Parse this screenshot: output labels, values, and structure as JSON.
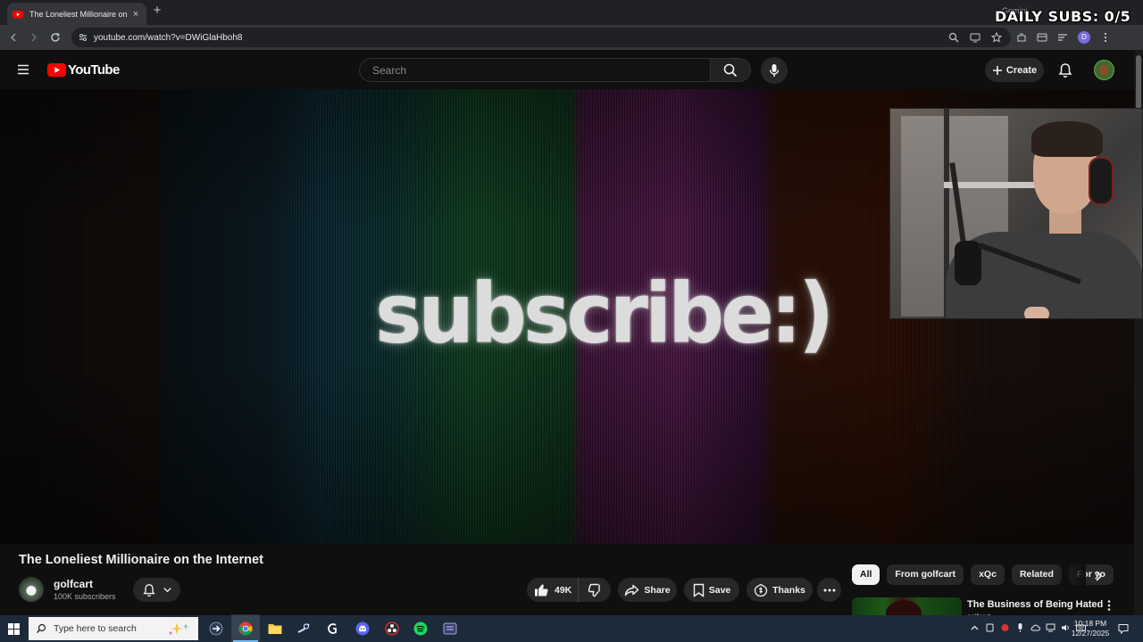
{
  "browser": {
    "tab_title": "The Loneliest Millionaire on the Internet",
    "tab_close": "×",
    "new_tab": "+",
    "gemini_label": "Gemini",
    "url": "youtube.com/watch?v=DWiGlaHboh8",
    "profile_initial": "D"
  },
  "overlay": {
    "daily_subs": "DAILY SUBS: 0/5"
  },
  "youtube": {
    "logo_text": "YouTube",
    "search_placeholder": "Search",
    "create_label": "Create"
  },
  "video": {
    "overlay_text": "subscribe:)",
    "title": "The Loneliest Millionaire on the Internet"
  },
  "channel": {
    "name": "golfcart",
    "subscribers": "100K subscribers"
  },
  "actions": {
    "like_count": "49K",
    "share": "Share",
    "save": "Save",
    "thanks": "Thanks"
  },
  "chips": [
    "All",
    "From golfcart",
    "xQc",
    "Related",
    "For yo"
  ],
  "recommendation": {
    "title": "The Business of Being Hated",
    "channel": "golfcart"
  },
  "taskbar": {
    "search_placeholder": "Type here to search",
    "time": "10:18 PM",
    "date": "12/27/2025"
  },
  "colors": {
    "youtube_red": "#ff0000",
    "background": "#0f0f0f",
    "taskbar": "#1d2a3a"
  }
}
